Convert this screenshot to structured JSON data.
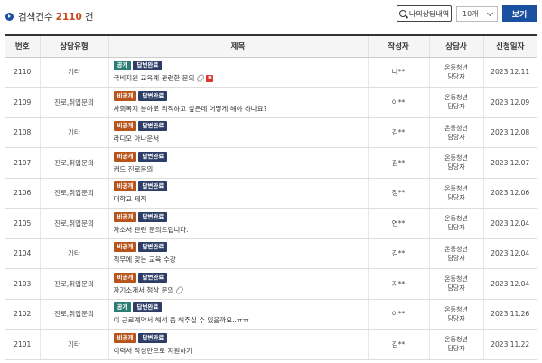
{
  "search": {
    "count_label": "검색건수",
    "count": "2110",
    "count_unit": "건",
    "my_history_label": "나의상담내역",
    "page_size_selected": "10개",
    "view_button": "보기"
  },
  "table": {
    "headers": [
      "번호",
      "상담유형",
      "제목",
      "작성자",
      "상담사",
      "신청일자"
    ],
    "rows": [
      {
        "no": "2110",
        "type": "기타",
        "visibility": "공개",
        "status": "답변완료",
        "subject": "국비지원 교육계 관련한 문의",
        "attach": true,
        "is_new": true,
        "new_label": "N",
        "author": "나**",
        "counselor_line1": "온동청년",
        "counselor_line2": "담당자",
        "date": "2023.12.11"
      },
      {
        "no": "2109",
        "type": "진로,취업문의",
        "visibility": "비공개",
        "status": "답변완료",
        "subject": "사회복지 분야로 취직하고 싶은데 어떻게 해야 하나요?",
        "attach": false,
        "is_new": false,
        "author": "이**",
        "counselor_line1": "온동청년",
        "counselor_line2": "담당자",
        "date": "2023.12.09"
      },
      {
        "no": "2108",
        "type": "기타",
        "visibility": "비공개",
        "status": "답변완료",
        "subject": "라디오 아나운서",
        "attach": false,
        "is_new": false,
        "author": "김**",
        "counselor_line1": "온동청년",
        "counselor_line2": "담당자",
        "date": "2023.12.08"
      },
      {
        "no": "2107",
        "type": "진로,취업문의",
        "visibility": "비공개",
        "status": "답변완료",
        "subject": "캐드 진로문의",
        "attach": false,
        "is_new": false,
        "author": "김**",
        "counselor_line1": "온동청년",
        "counselor_line2": "담당자",
        "date": "2023.12.07"
      },
      {
        "no": "2106",
        "type": "진로,취업문의",
        "visibility": "비공개",
        "status": "답변완료",
        "subject": "대학교 제적",
        "attach": false,
        "is_new": false,
        "author": "정**",
        "counselor_line1": "온동청년",
        "counselor_line2": "담당자",
        "date": "2023.12.06"
      },
      {
        "no": "2105",
        "type": "진로,취업문의",
        "visibility": "비공개",
        "status": "답변완료",
        "subject": "자소서 관련 문의드립니다.",
        "attach": false,
        "is_new": false,
        "author": "연**",
        "counselor_line1": "온동청년",
        "counselor_line2": "담당자",
        "date": "2023.12.04"
      },
      {
        "no": "2104",
        "type": "기타",
        "visibility": "비공개",
        "status": "답변완료",
        "subject": "직무에 맞는 교육 수강",
        "attach": false,
        "is_new": false,
        "author": "김**",
        "counselor_line1": "온동청년",
        "counselor_line2": "담당자",
        "date": "2023.12.04"
      },
      {
        "no": "2103",
        "type": "진로,취업문의",
        "visibility": "비공개",
        "status": "답변완료",
        "subject": "자기소개서 첨삭 문의",
        "attach": true,
        "is_new": false,
        "author": "지**",
        "counselor_line1": "온동청년",
        "counselor_line2": "담당자",
        "date": "2023.12.04"
      },
      {
        "no": "2102",
        "type": "진로,취업문의",
        "visibility": "공개",
        "status": "답변완료",
        "subject": "이 근로계약서 해석 좀 해주실 수 있을까요..ㅠㅠ",
        "attach": false,
        "is_new": false,
        "author": "이**",
        "counselor_line1": "온동청년",
        "counselor_line2": "담당자",
        "date": "2023.11.26"
      },
      {
        "no": "2101",
        "type": "기타",
        "visibility": "비공개",
        "status": "답변완료",
        "subject": "이력서 작성만으로 지원하기",
        "attach": false,
        "is_new": false,
        "author": "김**",
        "counselor_line1": "온동청년",
        "counselor_line2": "담당자",
        "date": "2023.11.22"
      }
    ]
  },
  "colors": {
    "primary": "#1b4fa0",
    "public_badge": "#2a7d74",
    "private_badge": "#b8541b",
    "done_badge": "#2d3e66",
    "count_highlight": "#c9471d"
  }
}
